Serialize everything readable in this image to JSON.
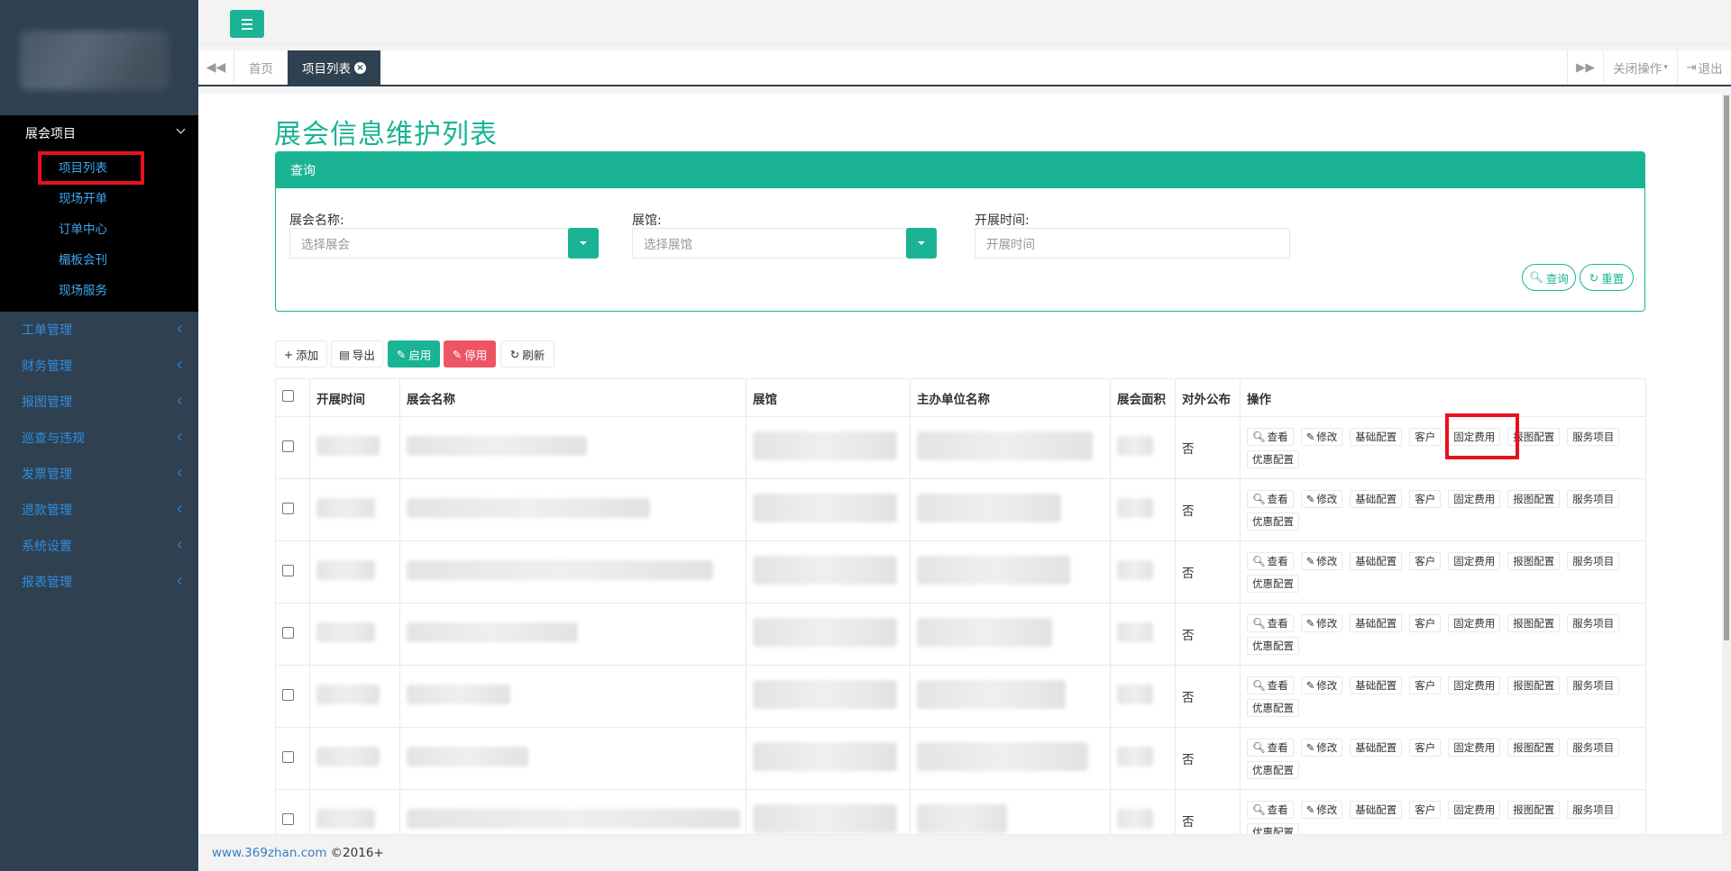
{
  "sidebar": {
    "active_group": "展会项目",
    "active_items": [
      {
        "label": "项目列表",
        "icon": "none"
      },
      {
        "label": "现场开单"
      },
      {
        "label": "订单中心"
      },
      {
        "label": "楣板会刊"
      },
      {
        "label": "现场服务"
      }
    ],
    "groups": [
      {
        "label": "工单管理"
      },
      {
        "label": "财务管理"
      },
      {
        "label": "报图管理"
      },
      {
        "label": "巡查与违规"
      },
      {
        "label": "发票管理"
      },
      {
        "label": "退款管理"
      },
      {
        "label": "系统设置"
      },
      {
        "label": "报表管理"
      }
    ]
  },
  "tabs": {
    "home": "首页",
    "current": "项目列表",
    "close_ops": "关闭操作",
    "logout": "退出"
  },
  "page": {
    "title": "展会信息维护列表"
  },
  "query": {
    "heading": "查询",
    "fields": {
      "exhibition_label": "展会名称:",
      "exhibition_placeholder": "选择展会",
      "venue_label": "展馆:",
      "venue_placeholder": "选择展馆",
      "time_label": "开展时间:",
      "time_placeholder": "开展时间"
    },
    "search_btn": "查询",
    "reset_btn": "重置"
  },
  "toolbar": {
    "add": "添加",
    "export": "导出",
    "enable": "启用",
    "disable": "停用",
    "refresh": "刷新"
  },
  "table": {
    "columns": [
      "开展时间",
      "展会名称",
      "展馆",
      "主办单位名称",
      "展会面积",
      "对外公布",
      "操作"
    ],
    "row_public_value": "否",
    "ops": [
      "查看",
      "修改",
      "基础配置",
      "客户",
      "固定费用",
      "报图配置",
      "服务项目",
      "优惠配置"
    ],
    "rows": [
      {
        "public": "否"
      },
      {
        "public": "否"
      },
      {
        "public": "否"
      },
      {
        "public": "否"
      },
      {
        "public": "否"
      },
      {
        "public": "否"
      },
      {
        "public": "否"
      }
    ]
  },
  "footer": {
    "link": "www.369zhan.com",
    "copyright": "©2016+"
  },
  "colors": {
    "accent": "#1ab394",
    "sidebar_bg": "#2f4050",
    "danger": "#ed5565",
    "highlight": "#e8101f"
  }
}
